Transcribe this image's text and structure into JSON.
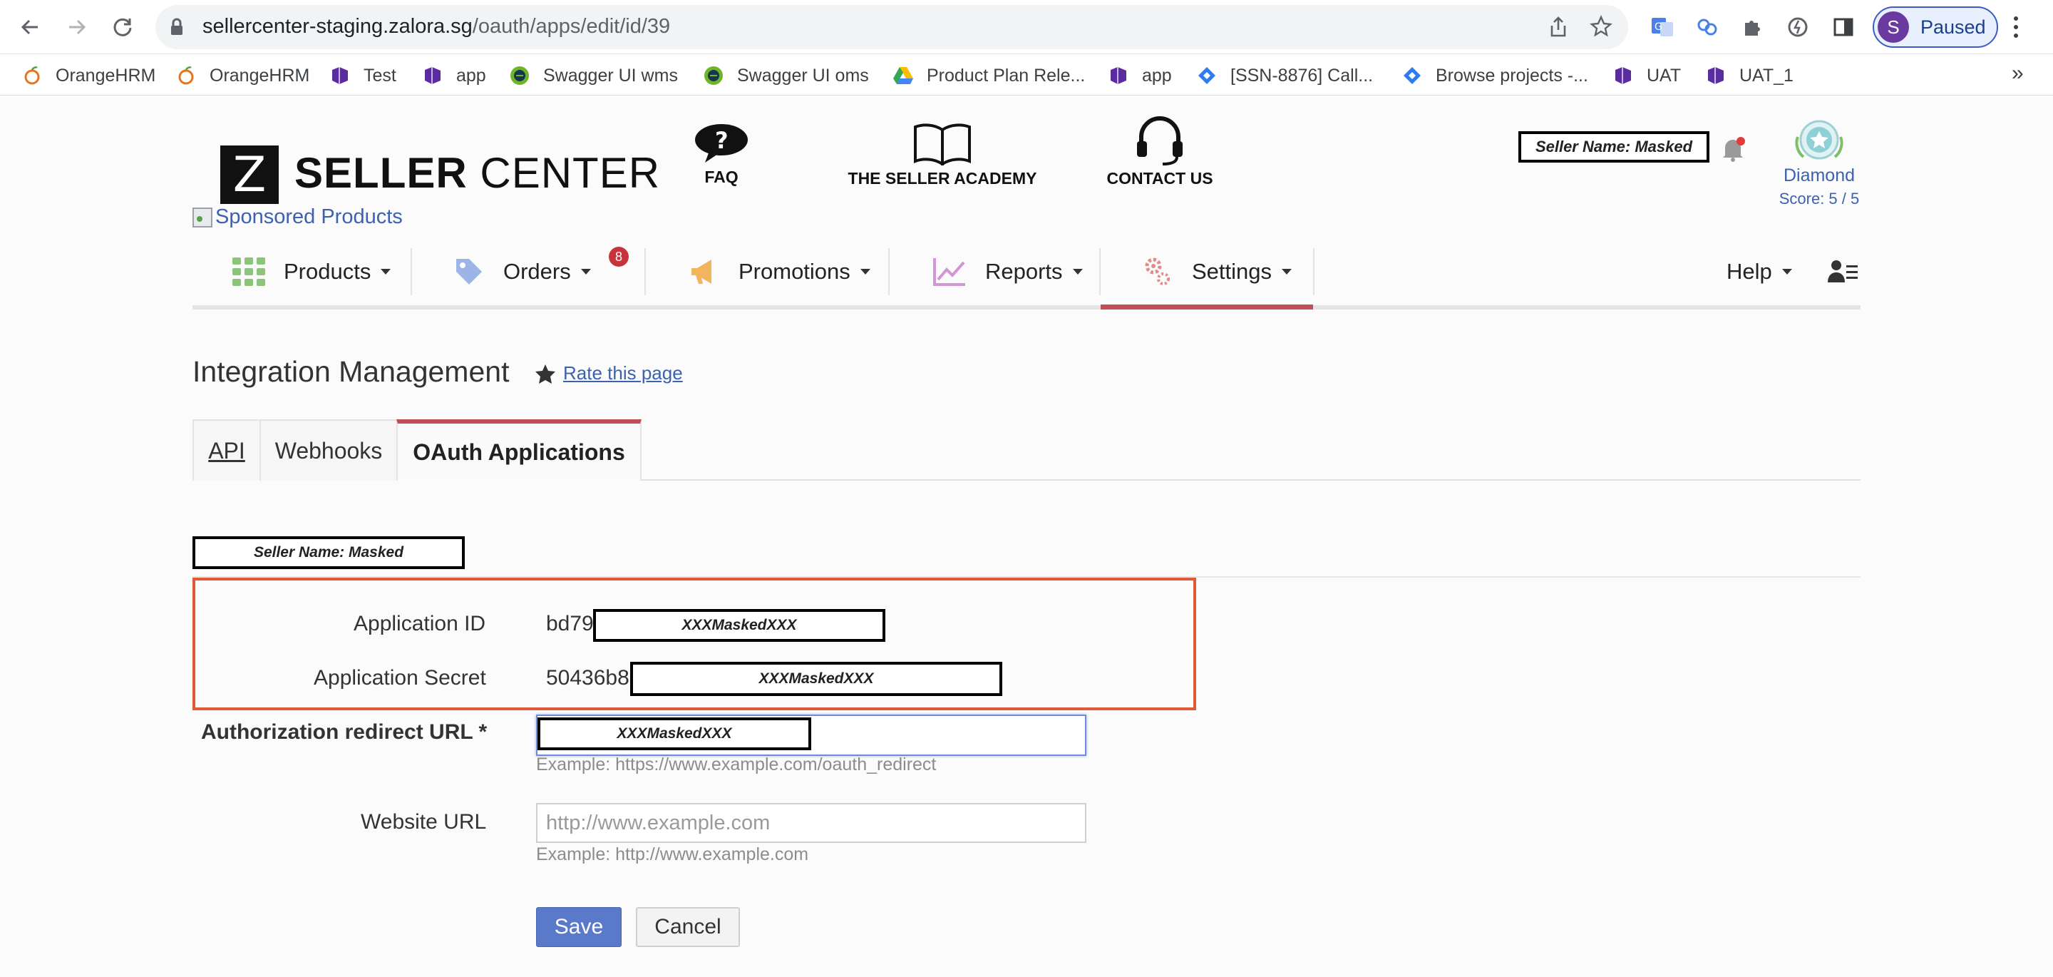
{
  "browser": {
    "url_host": "sellercenter-staging.zalora.sg",
    "url_path": "/oauth/apps/edit/id/39",
    "profile_initial": "S",
    "profile_status": "Paused",
    "bookmarks": [
      {
        "label": "OrangeHRM",
        "icon": "orange-icon"
      },
      {
        "label": "OrangeHRM",
        "icon": "orange-icon"
      },
      {
        "label": "Test",
        "icon": "app-icon"
      },
      {
        "label": "app",
        "icon": "app-icon"
      },
      {
        "label": "Swagger UI wms",
        "icon": "swagger-icon"
      },
      {
        "label": "Swagger UI oms",
        "icon": "swagger-icon"
      },
      {
        "label": "Product Plan Rele...",
        "icon": "drive-icon"
      },
      {
        "label": "app",
        "icon": "app-icon"
      },
      {
        "label": "[SSN-8876] Call...",
        "icon": "jira-icon"
      },
      {
        "label": "Browse projects -...",
        "icon": "jira-icon"
      },
      {
        "label": "UAT",
        "icon": "app-icon"
      },
      {
        "label": "UAT_1",
        "icon": "app-icon"
      }
    ],
    "more": "»"
  },
  "header": {
    "logo_letter": "Z",
    "logo_bold": "SELLER",
    "logo_light": "CENTER",
    "links": {
      "faq": "FAQ",
      "academy": "THE SELLER ACADEMY",
      "contact": "CONTACT US"
    },
    "seller_name": "Seller Name: Masked",
    "tier": "Diamond",
    "score": "Score: 5 / 5",
    "sponsored": "Sponsored Products"
  },
  "nav": {
    "products": "Products",
    "orders": "Orders",
    "orders_badge": "8",
    "promotions": "Promotions",
    "reports": "Reports",
    "settings": "Settings",
    "help": "Help"
  },
  "page": {
    "title": "Integration Management",
    "rate": "Rate this page",
    "tabs": {
      "api": "API",
      "webhooks": "Webhooks",
      "oauth": "OAuth Applications"
    },
    "seller_name": "Seller Name: Masked"
  },
  "form": {
    "app_id_label": "Application ID",
    "app_id_prefix": "bd79",
    "app_id_mask": "XXXMaskedXXX",
    "app_secret_label": "Application Secret",
    "app_secret_prefix": "50436b8",
    "app_secret_mask": "XXXMaskedXXX",
    "redirect_label": "Authorization redirect URL *",
    "redirect_mask": "XXXMaskedXXX",
    "redirect_hint": "Example: https://www.example.com/oauth_redirect",
    "website_label": "Website URL",
    "website_placeholder": "http://www.example.com",
    "website_hint": "Example: http://www.example.com",
    "save": "Save",
    "cancel": "Cancel"
  },
  "colors": {
    "accent_red": "#c04f55",
    "link_blue": "#3b62b0",
    "highlight_border": "#e05a3a",
    "primary_button": "#5a79c9"
  }
}
